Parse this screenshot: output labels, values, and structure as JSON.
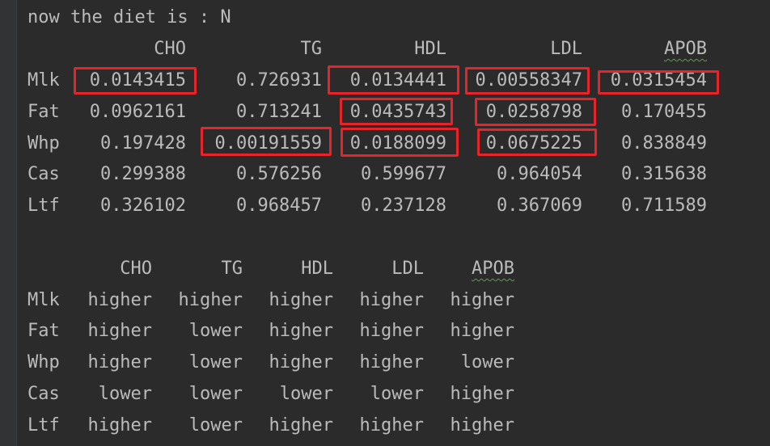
{
  "header_line": "now the diet is : N",
  "table1": {
    "columns": [
      "CHO",
      "TG",
      "HDL",
      "LDL",
      "APOB"
    ],
    "rows": [
      {
        "label": "Mlk",
        "values": [
          "0.0143415",
          "0.726931",
          "0.0134441",
          "0.00558347",
          "0.0315454"
        ]
      },
      {
        "label": "Fat",
        "values": [
          "0.0962161",
          "0.713241",
          "0.0435743",
          "0.0258798",
          "0.170455"
        ]
      },
      {
        "label": "Whp",
        "values": [
          "0.197428",
          "0.00191559",
          "0.0188099",
          "0.0675225",
          "0.838849"
        ]
      },
      {
        "label": "Cas",
        "values": [
          "0.299388",
          "0.576256",
          "0.599677",
          "0.964054",
          "0.315638"
        ]
      },
      {
        "label": "Ltf",
        "values": [
          "0.326102",
          "0.968457",
          "0.237128",
          "0.367069",
          "0.711589"
        ]
      }
    ]
  },
  "table2": {
    "columns": [
      "CHO",
      "TG",
      "HDL",
      "LDL",
      "APOB"
    ],
    "rows": [
      {
        "label": "Mlk",
        "values": [
          "higher",
          "higher",
          "higher",
          "higher",
          "higher"
        ]
      },
      {
        "label": "Fat",
        "values": [
          "higher",
          "lower",
          "higher",
          "higher",
          "higher"
        ]
      },
      {
        "label": "Whp",
        "values": [
          "higher",
          "lower",
          "higher",
          "higher",
          "lower"
        ]
      },
      {
        "label": "Cas",
        "values": [
          "lower",
          "lower",
          "lower",
          "lower",
          "higher"
        ]
      },
      {
        "label": "Ltf",
        "values": [
          "higher",
          "lower",
          "higher",
          "higher",
          "higher"
        ]
      }
    ]
  },
  "highlight_color": "#e8242a"
}
